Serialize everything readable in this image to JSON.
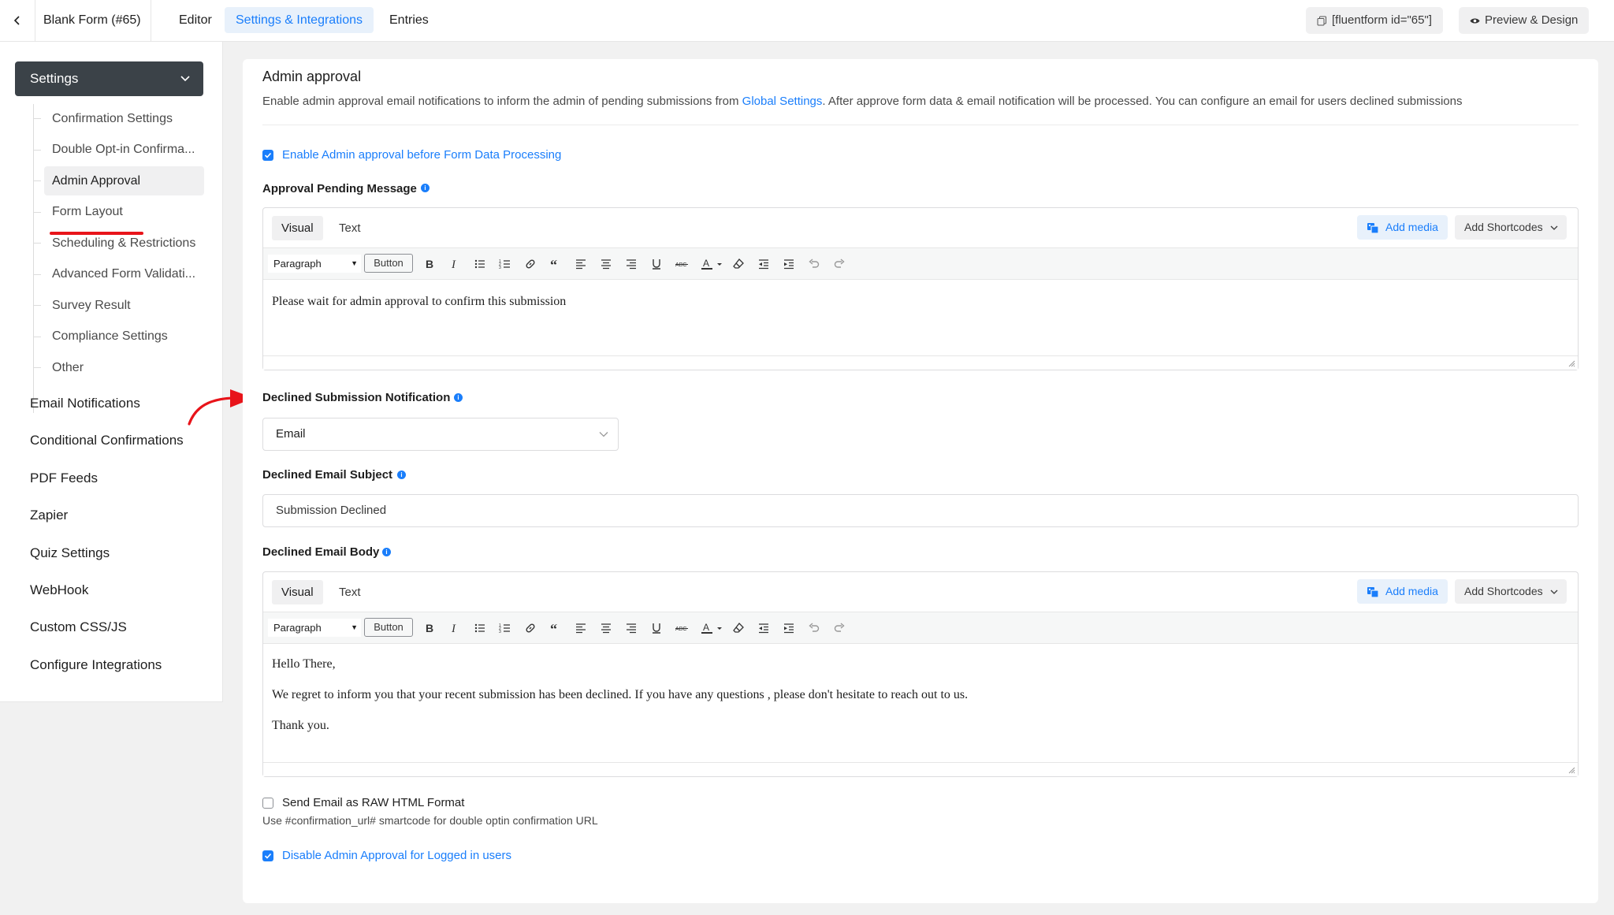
{
  "topbar": {
    "form_title": "Blank Form (#65)",
    "tabs": [
      "Editor",
      "Settings & Integrations",
      "Entries"
    ],
    "active_tab": "Settings & Integrations",
    "shortcode_label": "[fluentform id=\"65\"]",
    "preview_label": "Preview & Design"
  },
  "sidebar": {
    "settings_label": "Settings",
    "sub_items": [
      "Confirmation Settings",
      "Double Opt-in Confirma...",
      "Admin Approval",
      "Form Layout",
      "Scheduling & Restrictions",
      "Advanced Form Validati...",
      "Survey Result",
      "Compliance Settings",
      "Other"
    ],
    "active_sub_item": "Admin Approval",
    "main_items": [
      "Email Notifications",
      "Conditional Confirmations",
      "PDF Feeds",
      "Zapier",
      "Quiz Settings",
      "WebHook",
      "Custom CSS/JS",
      "Configure Integrations"
    ]
  },
  "main": {
    "title": "Admin approval",
    "description_before": "Enable admin approval email notifications to inform the admin of pending submissions from ",
    "description_link": "Global Settings",
    "description_after": ". After approve form data & email notification will be processed. You can configure an email for users declined submissions",
    "enable_checkbox": {
      "label": "Enable Admin approval before Form Data Processing",
      "checked": true
    },
    "pending_message": {
      "label": "Approval Pending Message",
      "editor": {
        "tab_visual": "Visual",
        "tab_text": "Text",
        "add_media": "Add media",
        "add_shortcodes": "Add Shortcodes",
        "paragraph": "Paragraph",
        "button": "Button",
        "content": [
          "Please wait for admin approval to confirm this submission"
        ]
      }
    },
    "declined_notification": {
      "label": "Declined Submission Notification",
      "value": "Email"
    },
    "declined_subject": {
      "label": "Declined Email Subject",
      "value": "Submission Declined"
    },
    "declined_body": {
      "label": "Declined Email Body",
      "editor": {
        "tab_visual": "Visual",
        "tab_text": "Text",
        "add_media": "Add media",
        "add_shortcodes": "Add Shortcodes",
        "paragraph": "Paragraph",
        "button": "Button",
        "content": [
          "Hello There,",
          "We regret to inform you that your recent submission has been declined. If you have any questions , please don't hesitate to reach out to us.",
          "Thank you."
        ]
      }
    },
    "raw_html_checkbox": {
      "label": "Send Email as RAW HTML Format",
      "checked": false
    },
    "smartcode_hint": "Use #confirmation_url# smartcode for double optin confirmation URL",
    "disable_logged_in_checkbox": {
      "label": "Disable Admin Approval for Logged in users",
      "checked": true
    }
  },
  "colors": {
    "accent": "#1a7efb",
    "annotation_red": "#e8141a",
    "settings_head": "#3b4248"
  }
}
